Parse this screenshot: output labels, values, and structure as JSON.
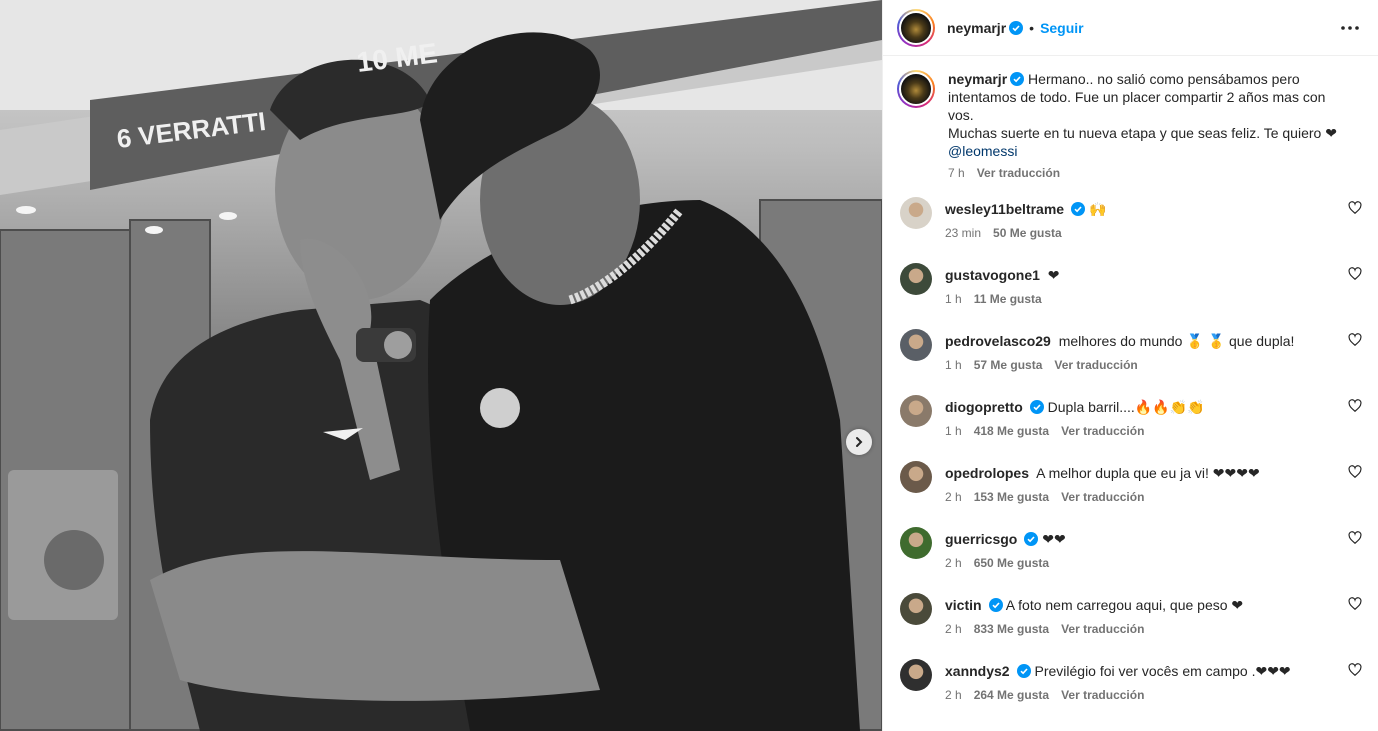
{
  "post": {
    "author": "neymarjr",
    "follow_label": "Seguir",
    "dot": "•",
    "more_icon": "more-horizontal-icon",
    "caption": {
      "line1": "Hermano.. no salió como pensábamos pero intentamos de todo. Fue un placer compartir 2 años mas con vos.",
      "line2": "Muchas suerte en tu nueva etapa y que seas feliz. Te quiero ❤",
      "mention": "@leomessi",
      "time": "7 h",
      "translate": "Ver traducción"
    },
    "photo": {
      "wall_texts": [
        "6 VERRATTI",
        "10 ME"
      ]
    }
  },
  "comments": [
    {
      "user": "wesley11beltrame",
      "verified": true,
      "text": "🙌",
      "time": "23 min",
      "likes": "50 Me gusta",
      "translate": ""
    },
    {
      "user": "gustavogone1",
      "verified": false,
      "text": "❤",
      "time": "1 h",
      "likes": "11 Me gusta",
      "translate": ""
    },
    {
      "user": "pedrovelasco29",
      "verified": false,
      "text": "melhores do mundo 🥇 🥇 que dupla!",
      "time": "1 h",
      "likes": "57 Me gusta",
      "translate": "Ver traducción"
    },
    {
      "user": "diogopretto",
      "verified": true,
      "text": "Dupla barril....🔥🔥👏👏",
      "time": "1 h",
      "likes": "418 Me gusta",
      "translate": "Ver traducción"
    },
    {
      "user": "opedrolopes",
      "verified": false,
      "text": "A melhor dupla que eu ja vi! ❤❤❤❤",
      "time": "2 h",
      "likes": "153 Me gusta",
      "translate": "Ver traducción"
    },
    {
      "user": "guerricsgo",
      "verified": true,
      "text": "❤❤",
      "time": "2 h",
      "likes": "650 Me gusta",
      "translate": ""
    },
    {
      "user": "victin",
      "verified": true,
      "text": "A foto nem carregou aqui, que peso ❤",
      "time": "2 h",
      "likes": "833 Me gusta",
      "translate": "Ver traducción"
    },
    {
      "user": "xanndys2",
      "verified": true,
      "text": "Previlégio foi ver vocês em campo .❤❤❤",
      "time": "2 h",
      "likes": "264 Me gusta",
      "translate": "Ver traducción"
    }
  ],
  "colors": {
    "link_blue": "#0095f6",
    "verified_blue": "#0095f6",
    "heart_red": "#ed4956",
    "muted": "#737373"
  }
}
